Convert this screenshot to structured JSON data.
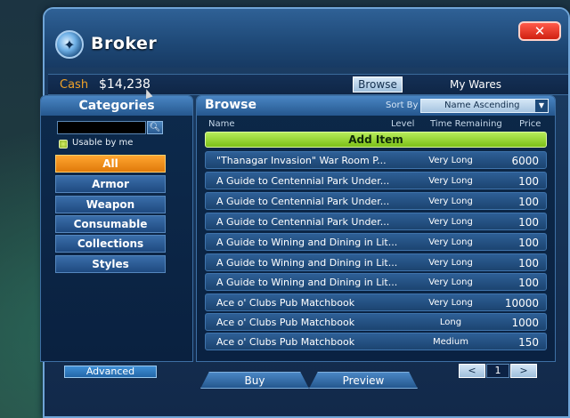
{
  "window": {
    "title": "Broker",
    "close_label": "✕"
  },
  "cash": {
    "label": "Cash",
    "value": "$14,238"
  },
  "tabs": {
    "browse": "Browse",
    "my_wares": "My Wares"
  },
  "categories": {
    "title": "Categories",
    "search_placeholder": "",
    "usable_label": "Usable by me",
    "items": [
      {
        "label": "All",
        "active": true
      },
      {
        "label": "Armor"
      },
      {
        "label": "Weapon"
      },
      {
        "label": "Consumable"
      },
      {
        "label": "Collections"
      },
      {
        "label": "Styles"
      }
    ],
    "advanced_label": "Advanced"
  },
  "browse": {
    "title": "Browse",
    "sort_label": "Sort By",
    "sort_value": "Name Ascending",
    "columns": {
      "name": "Name",
      "level": "Level",
      "time": "Time Remaining",
      "price": "Price"
    },
    "add_item_label": "Add Item",
    "rows": [
      {
        "name": "\"Thanagar Invasion\" War Room P...",
        "time": "Very Long",
        "price": "6000"
      },
      {
        "name": "A Guide to Centennial Park Under...",
        "time": "Very Long",
        "price": "100"
      },
      {
        "name": "A Guide to Centennial Park Under...",
        "time": "Very Long",
        "price": "100"
      },
      {
        "name": "A Guide to Centennial Park Under...",
        "time": "Very Long",
        "price": "100"
      },
      {
        "name": "A Guide to Wining and Dining in Lit...",
        "time": "Very Long",
        "price": "100"
      },
      {
        "name": "A Guide to Wining and Dining in Lit...",
        "time": "Very Long",
        "price": "100"
      },
      {
        "name": "A Guide to Wining and Dining in Lit...",
        "time": "Very Long",
        "price": "100"
      },
      {
        "name": "Ace o' Clubs Pub Matchbook",
        "time": "Very Long",
        "price": "10000"
      },
      {
        "name": "Ace o' Clubs Pub Matchbook",
        "time": "Long",
        "price": "1000"
      },
      {
        "name": "Ace o' Clubs Pub Matchbook",
        "time": "Medium",
        "price": "150"
      }
    ]
  },
  "actions": {
    "buy": "Buy",
    "preview": "Preview"
  },
  "pager": {
    "prev": "<",
    "page": "1",
    "next": ">"
  },
  "colors": {
    "accent": "#f0a228",
    "active_category": "#ffa530",
    "add_item": "#9ad63a",
    "panel_header": "#4a86c4",
    "close": "#e03020"
  }
}
